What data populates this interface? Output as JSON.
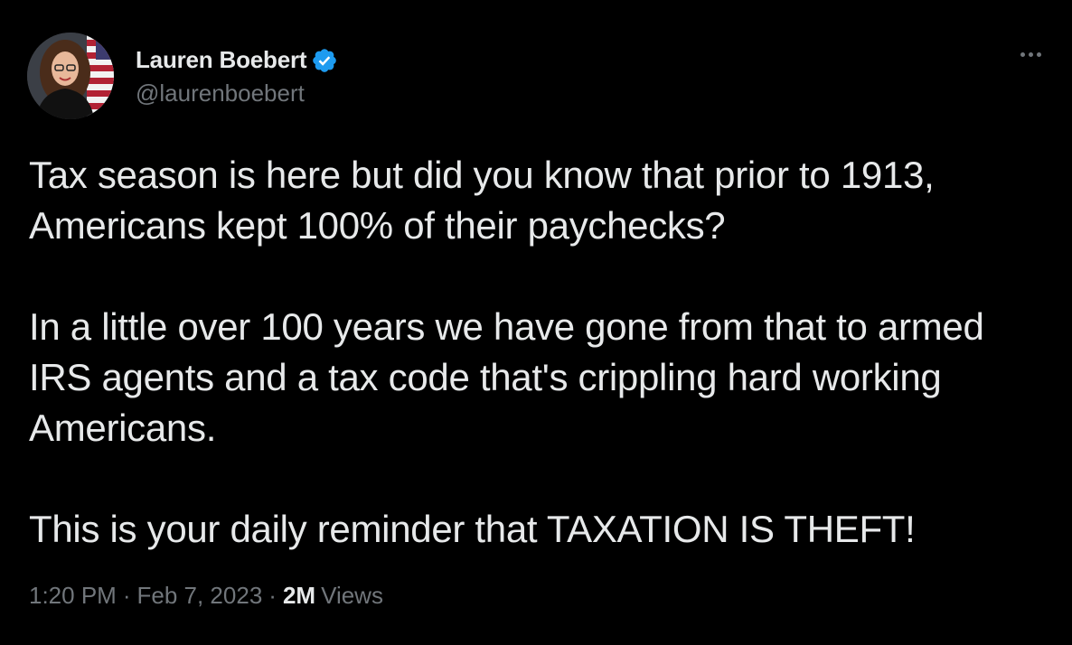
{
  "author": {
    "display_name": "Lauren Boebert",
    "handle": "@laurenboebert",
    "verified": true,
    "verified_color": "#1d9bf0"
  },
  "more_icon": "more-horizontal-icon",
  "tweet": {
    "paragraphs": [
      "Tax season is here but did you know that prior to 1913, Americans kept 100% of their paychecks?",
      "In a little over 100 years we have gone from that to armed IRS agents and a tax code that's crippling hard working Americans.",
      "This is your daily reminder that TAXATION IS THEFT!"
    ]
  },
  "meta": {
    "time": "1:20 PM",
    "separator": "·",
    "date": "Feb 7, 2023",
    "views_count": "2M",
    "views_label": "Views"
  },
  "colors": {
    "background": "#000000",
    "text_primary": "#e7e9ea",
    "text_secondary": "#71767b"
  }
}
